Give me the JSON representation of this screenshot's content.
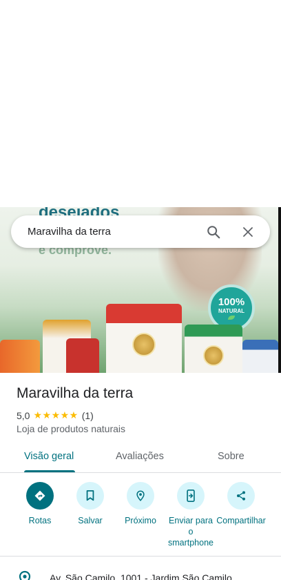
{
  "hero": {
    "headline": "desejados",
    "subline": "e comprove.",
    "badge_top": "100%",
    "badge_bottom": "NATURAL"
  },
  "search": {
    "query": "Maravilha da terra",
    "search_icon": "search-icon",
    "clear_icon": "close-icon"
  },
  "place": {
    "name": "Maravilha da terra",
    "rating": "5,0",
    "stars": "★★★★★",
    "review_count": "(1)",
    "category": "Loja de produtos naturais"
  },
  "tabs": [
    {
      "label": "Visão geral",
      "active": true
    },
    {
      "label": "Avaliações",
      "active": false
    },
    {
      "label": "Sobre",
      "active": false
    }
  ],
  "actions": [
    {
      "label": "Rotas",
      "icon": "directions-icon"
    },
    {
      "label": "Salvar",
      "icon": "bookmark-icon"
    },
    {
      "label": "Próximo",
      "icon": "nearby-icon"
    },
    {
      "label": "Enviar para o smartphone",
      "icon": "send-to-phone-icon"
    },
    {
      "label": "Compartilhar",
      "icon": "share-icon"
    }
  ],
  "address": {
    "text": "Av. São Camilo, 1001 - Jardim São Camilo",
    "icon": "location-pin-icon"
  },
  "colors": {
    "accent": "#00717f",
    "action_bg": "#d6f5fb",
    "star": "#fbbc04"
  }
}
